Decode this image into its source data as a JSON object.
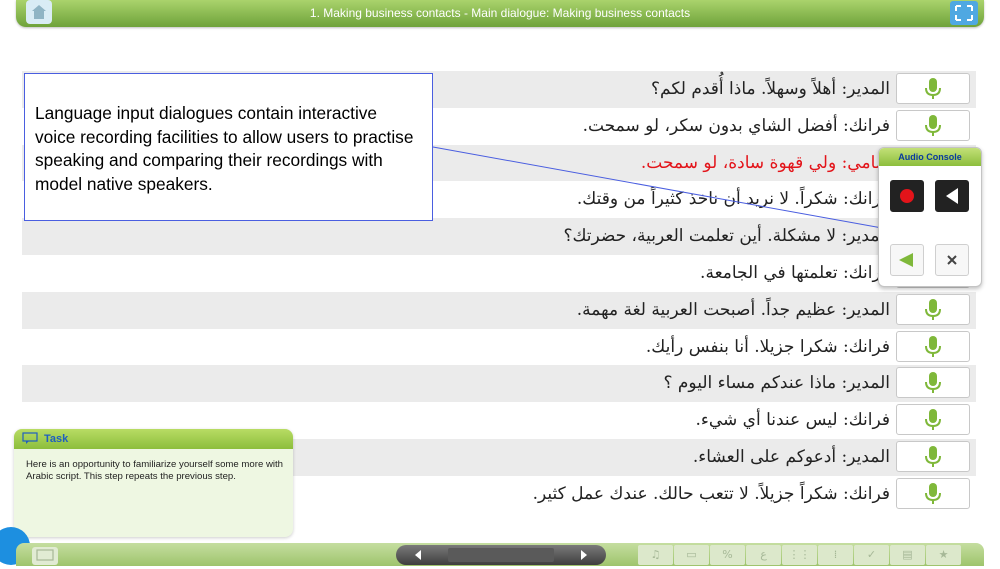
{
  "header": {
    "title": "1. Making business contacts - Main dialogue: Making business contacts"
  },
  "dialogue": [
    {
      "text": "المدير: أهلاً وسهلاً. ماذا أُقدم لكم؟",
      "shade": true,
      "color": "#222222"
    },
    {
      "text": "فرانك: أفضل الشاي بدون سكر، لو سمحت.",
      "shade": false,
      "color": "#222222"
    },
    {
      "text": "سامي: ولي قهوة سادة، لو سمحت.",
      "shade": true,
      "color": "#e3141a"
    },
    {
      "text": "فرانك: شكراً. لا نريد أن ناخذ كثيراً من وقتك.",
      "shade": false,
      "color": "#222222"
    },
    {
      "text": "المدير: لا مشكلة. أين تعلمت العربية، حضرتك؟",
      "shade": true,
      "color": "#222222"
    },
    {
      "text": "فرانك: تعلمتها في الجامعة.",
      "shade": false,
      "color": "#222222"
    },
    {
      "text": "المدير: عظيم جداً. أصبحت العربية لغة مهمة.",
      "shade": true,
      "color": "#222222"
    },
    {
      "text": "فرانك: شكرا جزيلا. أنا بنفس رأيك.",
      "shade": false,
      "color": "#222222"
    },
    {
      "text": "المدير: ماذا عندكم مساء اليوم ؟",
      "shade": true,
      "color": "#222222"
    },
    {
      "text": "فرانك: ليس عندنا أي شيء.",
      "shade": false,
      "color": "#222222"
    },
    {
      "text": "المدير: أدعوكم على العشاء.",
      "shade": true,
      "color": "#222222"
    },
    {
      "text": "فرانك: شكراً جزيلاً. لا تتعب حالك. عندك عمل كثير.",
      "shade": false,
      "color": "#222222"
    }
  ],
  "callout": {
    "text": "Language input dialogues contain interactive voice recording facilities to allow users to practise speaking and comparing their recordings with model native speakers."
  },
  "audio_console": {
    "title": "Audio Console",
    "icons": [
      "record-icon",
      "play-icon",
      "speaker-icon",
      "close-icon"
    ]
  },
  "task": {
    "title": "Task",
    "text": "Here is an opportunity to familiarize yourself some more with Arabic script. This step repeats the previous step."
  },
  "toolbar": {
    "tools": [
      "♫",
      "▭",
      "%",
      "ﻉ",
      "⋮⋮",
      "⁞",
      "✓",
      "▤",
      "★"
    ]
  },
  "colors": {
    "accent_green": "#8cbe3c",
    "highlight_red": "#e3141a",
    "callout_border": "#4a5ee0"
  }
}
